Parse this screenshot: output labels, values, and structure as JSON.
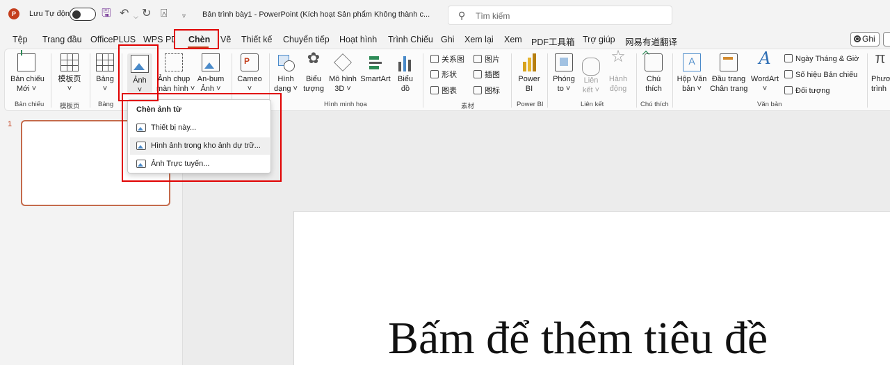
{
  "titlebar": {
    "logo_letter": "P",
    "autosave_label": "Lưu Tự động",
    "doc_title": "Bản trình bày1  -  PowerPoint (Kích hoạt Sản phẩm Không thành c...",
    "search_placeholder": "Tìm kiếm"
  },
  "tabs": [
    "Tệp",
    "Trang đầu",
    "OfficePLUS",
    "WPS PDF",
    "Chèn",
    "Vẽ",
    "Thiết kế",
    "Chuyển tiếp",
    "Hoạt hình",
    "Trình Chiếu",
    "Ghi",
    "Xem lại",
    "Xem",
    "PDF工具箱",
    "Trợ giúp",
    "网易有道翻译"
  ],
  "active_tab": "Chèn",
  "record_button": "Ghi",
  "ribbon": {
    "new_slide": [
      "Bản chiếu",
      "Mới ˅"
    ],
    "template": [
      "模板页",
      "˅"
    ],
    "table": [
      "Bảng",
      "˅"
    ],
    "picture": [
      "Ảnh",
      "˅"
    ],
    "screenshot": [
      "Ảnh chụp",
      "màn hình ˅"
    ],
    "album": [
      "An-bum",
      "Ảnh ˅"
    ],
    "cameo": [
      "Cameo",
      "˅"
    ],
    "shapes": [
      "Hình",
      "dạng ˅"
    ],
    "icons": [
      "Biểu",
      "tượng"
    ],
    "models3d": [
      "Mô hình",
      "3D ˅"
    ],
    "smartart": [
      "SmartArt",
      ""
    ],
    "chart": [
      "Biểu",
      "đồ"
    ],
    "sucai_items": [
      "关系图",
      "形状",
      "图表",
      "图片",
      "插图",
      "图标"
    ],
    "powerbi": [
      "Power",
      "BI"
    ],
    "zoom": [
      "Phóng",
      "to ˅"
    ],
    "link": [
      "Liên",
      "kết ˅"
    ],
    "action": [
      "Hành",
      "động"
    ],
    "comment": [
      "Chú",
      "thích"
    ],
    "textbox": [
      "Hộp Văn",
      "bản ˅"
    ],
    "header_footer": [
      "Đầu trang",
      "Chân trang"
    ],
    "wordart": [
      "WordArt",
      "˅"
    ],
    "text_small": [
      "Ngày Tháng & Giờ",
      "Số hiệu Bản chiếu",
      "Đối tượng"
    ],
    "formula": [
      "Phươ",
      "trình"
    ],
    "group_labels": {
      "slides": "Bản chiếu",
      "template": "模板页",
      "table": "Bảng",
      "illustrations": "Hình minh họa",
      "sucai": "素材",
      "powerbi": "Power BI",
      "links": "Liên kết",
      "comments": "Chú thích",
      "text": "Văn bản"
    }
  },
  "dropdown": {
    "header": "Chèn ảnh từ",
    "items": [
      "Thiết bị này...",
      "Hình ảnh trong kho ảnh dự trữ...",
      "Ảnh Trực tuyến..."
    ],
    "highlighted_index": 1
  },
  "thumbnail": {
    "number": "1"
  },
  "slide": {
    "title_placeholder": "Bấm để thêm tiêu đề"
  },
  "colors": {
    "accent": "#c43e1c",
    "highlight_box": "#e00000"
  }
}
